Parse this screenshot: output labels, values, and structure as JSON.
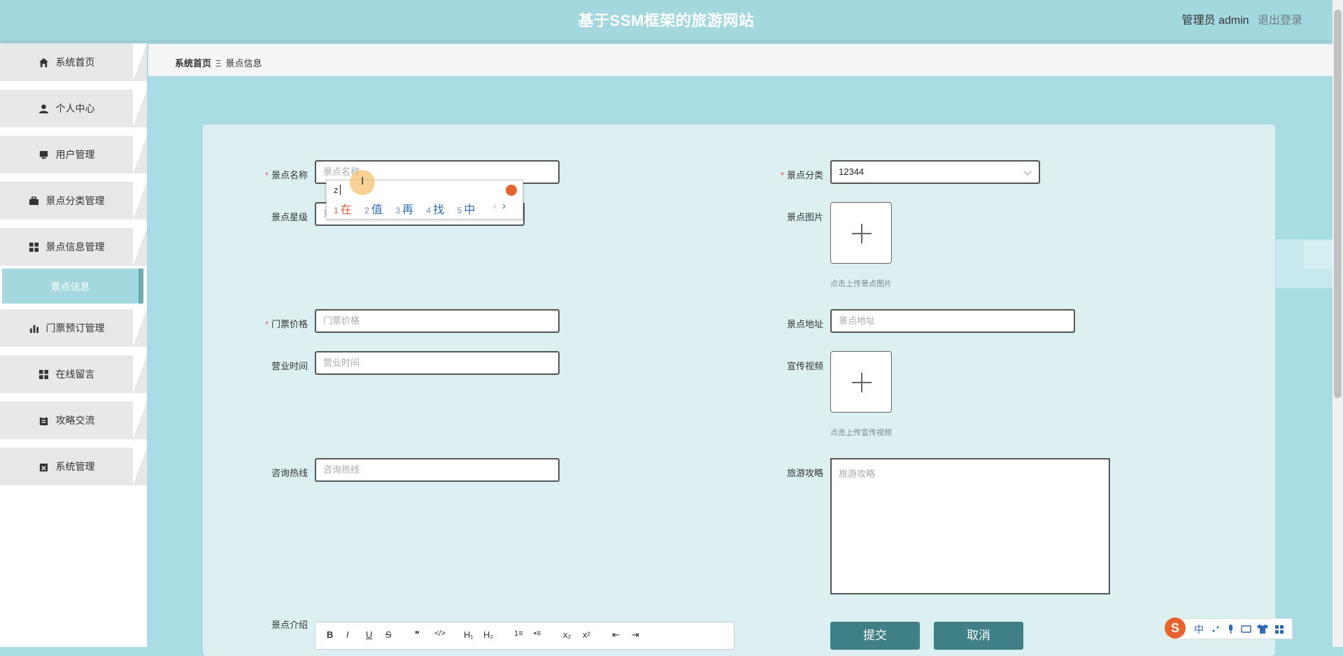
{
  "header": {
    "title": "基于SSM框架的旅游网站",
    "user": "管理员 admin",
    "logout": "退出登录"
  },
  "sidebar": {
    "items": [
      {
        "label": "系统首页",
        "icon": "home-icon"
      },
      {
        "label": "个人中心",
        "icon": "user-icon"
      },
      {
        "label": "用户管理",
        "icon": "monitor-icon"
      },
      {
        "label": "景点分类管理",
        "icon": "briefcase-icon"
      },
      {
        "label": "景点信息管理",
        "icon": "grid-icon"
      },
      {
        "label": "门票预订管理",
        "icon": "chart-icon"
      },
      {
        "label": "在线留言",
        "icon": "grid-icon"
      },
      {
        "label": "攻略交流",
        "icon": "clipboard-icon"
      },
      {
        "label": "系统管理",
        "icon": "clipboard-x-icon"
      }
    ],
    "active_sub": "景点信息"
  },
  "breadcrumb": {
    "home": "系统首页",
    "separator": "Ξ",
    "current": "景点信息"
  },
  "form": {
    "name": {
      "label": "景点名称",
      "placeholder": "景点名称",
      "required": true
    },
    "category": {
      "label": "景点分类",
      "value": "12344",
      "required": true
    },
    "star": {
      "label": "景点星级",
      "placeholder": "景点星级"
    },
    "image": {
      "label": "景点图片",
      "hint": "点击上传景点图片"
    },
    "price": {
      "label": "门票价格",
      "placeholder": "门票价格",
      "required": true
    },
    "address": {
      "label": "景点地址",
      "placeholder": "景点地址"
    },
    "hours": {
      "label": "营业时间",
      "placeholder": "营业时间"
    },
    "video": {
      "label": "宣传视频",
      "hint": "点击上传宣传视频"
    },
    "hotline": {
      "label": "咨询热线",
      "placeholder": "咨询热线"
    },
    "guide": {
      "label": "旅游攻略",
      "placeholder": "旅游攻略"
    },
    "intro": {
      "label": "景点介绍"
    },
    "submit": "提交",
    "cancel": "取消"
  },
  "editor_toolbar": [
    "B",
    "I",
    "U",
    "S",
    "❞",
    "</>",
    "H₁",
    "H₂",
    "1≡",
    "•≡",
    "x₂",
    "x²",
    "⇤",
    "⇥"
  ],
  "ime": {
    "input": "z",
    "candidates": [
      {
        "num": "1",
        "text": "在"
      },
      {
        "num": "2",
        "text": "值"
      },
      {
        "num": "3",
        "text": "再"
      },
      {
        "num": "4",
        "text": "找"
      },
      {
        "num": "5",
        "text": "中"
      }
    ],
    "prev": "‹",
    "next": "›"
  },
  "sogou": {
    "logo": "S",
    "mode": "中"
  }
}
